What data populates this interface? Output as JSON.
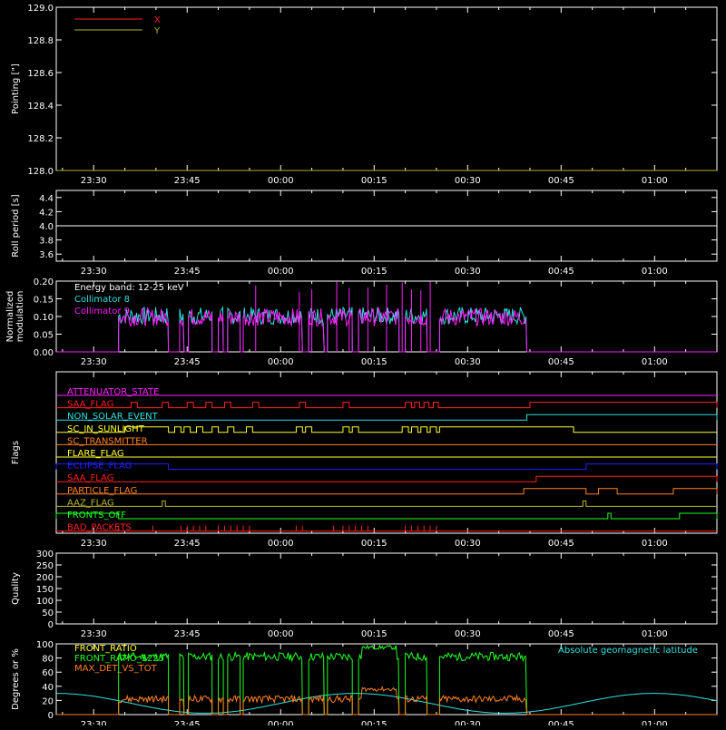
{
  "time_axis": {
    "start_min": -36,
    "end_min": 70,
    "tick_labels": [
      "23:30",
      "23:45",
      "00:00",
      "00:15",
      "00:30",
      "00:45",
      "01:00"
    ],
    "tick_minutes": [
      -30,
      -15,
      0,
      15,
      30,
      45,
      60
    ]
  },
  "chart_data": [
    {
      "type": "line",
      "id": "pointing",
      "ylabel": "Pointing [\"]",
      "ylim": [
        128.0,
        129.0
      ],
      "yticks": [
        "128.0",
        "128.2",
        "128.4",
        "128.6",
        "128.8",
        "129.0"
      ],
      "yticks_values": [
        128.0,
        128.2,
        128.4,
        128.6,
        128.8,
        129.0
      ],
      "series": [
        {
          "name": "X",
          "color": "#ff2020",
          "x": [
            -36,
            70
          ],
          "y": [
            128.0,
            128.0
          ]
        },
        {
          "name": "Y",
          "color": "#b5b52c",
          "x": [
            -36,
            70
          ],
          "y": [
            128.0,
            128.0
          ]
        }
      ]
    },
    {
      "type": "line",
      "id": "roll",
      "ylabel": "Roll period [s]",
      "ylim": [
        3.5,
        4.5
      ],
      "yticks": [
        "3.6",
        "3.8",
        "4.0",
        "4.2",
        "4.4"
      ],
      "yticks_values": [
        3.6,
        3.8,
        4.0,
        4.2,
        4.4
      ],
      "series": [
        {
          "name": "",
          "color": "#ffffff",
          "x": [
            -36,
            70
          ],
          "y": [
            4.0,
            4.0
          ]
        }
      ]
    },
    {
      "type": "line",
      "id": "modulation",
      "ylabel": "Normalized modulation",
      "ylabel_lines": [
        "Normalized",
        "modulation"
      ],
      "ylim": [
        0.0,
        0.2
      ],
      "yticks": [
        "0.00",
        "0.05",
        "0.10",
        "0.15",
        "0.20"
      ],
      "yticks_values": [
        0.0,
        0.05,
        0.1,
        0.15,
        0.2
      ],
      "annotation": "Energy band: 12-25 keV",
      "series": [
        {
          "name": "Collimator 8",
          "color": "#30e0e0"
        },
        {
          "name": "Collimator 9",
          "color": "#ff20ff"
        }
      ],
      "active_segments": [
        [
          -26,
          -18
        ],
        [
          -16.2,
          -15.5
        ],
        [
          -14.8,
          -11
        ],
        [
          -10,
          -9.2
        ],
        [
          -8.5,
          -6.5
        ],
        [
          -6,
          3.5
        ],
        [
          4.5,
          7
        ],
        [
          7.5,
          11.5
        ],
        [
          12.5,
          19
        ],
        [
          20,
          23.5
        ],
        [
          25.5,
          39.5
        ]
      ],
      "level": 0.098
    },
    {
      "type": "line",
      "id": "flags",
      "ylabel": "Flags",
      "flags": [
        {
          "name": "ATTENUATOR_STATE",
          "color": "#ff20ff",
          "on": []
        },
        {
          "name": "SAA_FLAG",
          "color": "#ff2020",
          "on": [
            [
              -24,
              -23
            ],
            [
              -19,
              -18
            ],
            [
              -15,
              -14
            ],
            [
              -12,
              -11
            ],
            [
              -9,
              -8
            ],
            [
              -4.5,
              -3.5
            ],
            [
              3,
              4
            ],
            [
              10,
              11
            ],
            [
              20,
              21
            ],
            [
              21.5,
              22.3
            ],
            [
              23,
              23.8
            ],
            [
              24.5,
              25.3
            ],
            [
              40,
              70
            ]
          ]
        },
        {
          "name": "NON_SOLAR_EVENT",
          "color": "#30e0e0",
          "on": [
            [
              39.5,
              70
            ]
          ]
        },
        {
          "name": "SC_IN_SUNLIGHT",
          "color": "#ffff30",
          "on": [
            [
              -25,
              -18
            ],
            [
              -17,
              -16
            ],
            [
              -15.5,
              -14.5
            ],
            [
              -13.5,
              -12.5
            ],
            [
              -11,
              -10
            ],
            [
              -8.5,
              -7.5
            ],
            [
              -5.5,
              -4.5
            ],
            [
              2.5,
              3.5
            ],
            [
              4,
              5
            ],
            [
              10,
              11
            ],
            [
              11.5,
              12.5
            ],
            [
              19.5,
              20.5
            ],
            [
              21,
              22
            ],
            [
              22.5,
              23.5
            ],
            [
              24,
              25
            ],
            [
              25.5,
              47
            ]
          ]
        },
        {
          "name": "SC_TRANSMITTER",
          "color": "#ff8020",
          "on": []
        },
        {
          "name": "FLARE_FLAG",
          "color": "#ffff30",
          "on": []
        },
        {
          "name": "ECLIPSE_FLAG",
          "color": "#2020ff",
          "on": [
            [
              -36,
              -18
            ],
            [
              49,
              70
            ]
          ]
        },
        {
          "name": "SAA_FLAG",
          "color": "#ff2020",
          "on": [
            [
              41,
              70
            ]
          ]
        },
        {
          "name": "PARTICLE_FLAG",
          "color": "#ff8020",
          "on": [
            [
              39,
              49
            ],
            [
              51,
              54
            ],
            [
              63,
              70
            ]
          ]
        },
        {
          "name": "AAZ_FLAG",
          "color": "#b5b52c",
          "on": [
            [
              -19,
              -18.5
            ],
            [
              48.5,
              49
            ]
          ]
        },
        {
          "name": "FRONTS_OFF",
          "color": "#20ff20",
          "on": [
            [
              -36,
              -26
            ],
            [
              52.5,
              53
            ],
            [
              64,
              70
            ]
          ]
        },
        {
          "name": "BAD_PACKETS",
          "color": "#ff2020",
          "spikes": [
            -26,
            -20.5,
            -16,
            -15,
            -14,
            -13,
            -12,
            -10,
            -9,
            -8,
            -7,
            -6,
            -5,
            2.5,
            3.5,
            8.5,
            10,
            11,
            12,
            13,
            14,
            20,
            21,
            22,
            23,
            24,
            25
          ]
        }
      ]
    },
    {
      "type": "line",
      "id": "quality",
      "ylabel": "Quality",
      "ylim": [
        0,
        300
      ],
      "yticks": [
        "0",
        "50",
        "100",
        "150",
        "200",
        "250",
        "300"
      ],
      "yticks_values": [
        0,
        50,
        100,
        150,
        200,
        250,
        300
      ],
      "series": [
        {
          "name": "",
          "color": "#ffffff",
          "x": [
            -36,
            70
          ],
          "y": [
            300,
            300
          ]
        }
      ]
    },
    {
      "type": "line",
      "id": "ratios",
      "ylabel": "Degrees or %",
      "ylim": [
        0,
        100
      ],
      "yticks": [
        "0",
        "20",
        "40",
        "60",
        "80",
        "100"
      ],
      "yticks_values": [
        0,
        20,
        40,
        60,
        80,
        100
      ],
      "series": [
        {
          "name": "FRONT_RATIO",
          "color": "#ffff30"
        },
        {
          "name": "FRONT_RATIO_1225",
          "color": "#20ff20"
        },
        {
          "name": "MAX_DET_VS_TOT",
          "color": "#ff8020"
        },
        {
          "name": "Absolute geomagnetic latitude",
          "color": "#30e0e0"
        }
      ],
      "front_ratio_segments": [
        [
          -26,
          -18
        ],
        [
          -16.2,
          -15.5
        ],
        [
          -14.8,
          -11
        ],
        [
          -10,
          -9.2
        ],
        [
          -8.5,
          -6.5
        ],
        [
          -6,
          3.5
        ],
        [
          4.5,
          7
        ],
        [
          7.5,
          11.5
        ],
        [
          12.5,
          19
        ],
        [
          20,
          23.5
        ],
        [
          25.5,
          39.5
        ]
      ],
      "green_level": 82,
      "high_segment": [
        13,
        18.5
      ],
      "orange_level": 22
    }
  ]
}
